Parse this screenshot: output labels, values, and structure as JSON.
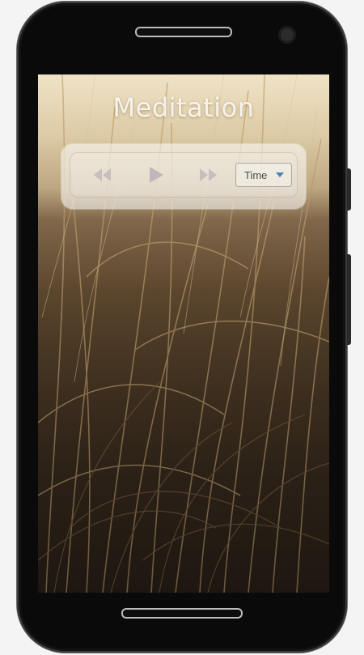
{
  "app": {
    "title": "Meditation"
  },
  "player": {
    "rewind_icon": "rewind-icon",
    "play_icon": "play-icon",
    "forward_icon": "fast-forward-icon",
    "time_select": {
      "selected": "Time"
    }
  },
  "colors": {
    "control_tint": "#b9b0b6",
    "select_caret": "#4f83b8"
  }
}
